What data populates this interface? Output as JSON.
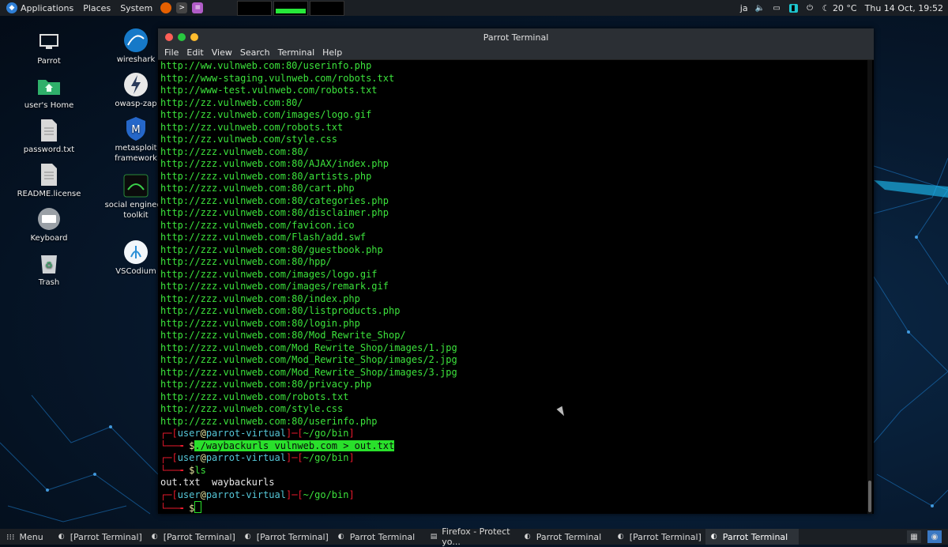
{
  "top_panel": {
    "menus": [
      "Applications",
      "Places",
      "System"
    ],
    "keyboard_layout": "ja",
    "weather": "20 °C",
    "clock": "Thu 14 Oct, 19:52"
  },
  "desktop_icons": {
    "col1": [
      "Parrot",
      "user's Home",
      "password.txt",
      "README.license",
      "Keyboard",
      "Trash"
    ],
    "col2": [
      "wireshark",
      "owasp-zap",
      "metasploit\nframework",
      "social engineeri\ntoolkit",
      "VSCodium"
    ]
  },
  "window": {
    "title": "Parrot Terminal",
    "menu": [
      "File",
      "Edit",
      "View",
      "Search",
      "Terminal",
      "Help"
    ]
  },
  "terminal": {
    "urls": [
      "http://ww.vulnweb.com:80/userinfo.php",
      "http://www-staging.vulnweb.com/robots.txt",
      "http://www-test.vulnweb.com/robots.txt",
      "http://zz.vulnweb.com:80/",
      "http://zz.vulnweb.com/images/logo.gif",
      "http://zz.vulnweb.com/robots.txt",
      "http://zz.vulnweb.com/style.css",
      "http://zzz.vulnweb.com:80/",
      "http://zzz.vulnweb.com:80/AJAX/index.php",
      "http://zzz.vulnweb.com:80/artists.php",
      "http://zzz.vulnweb.com:80/cart.php",
      "http://zzz.vulnweb.com:80/categories.php",
      "http://zzz.vulnweb.com:80/disclaimer.php",
      "http://zzz.vulnweb.com/favicon.ico",
      "http://zzz.vulnweb.com/Flash/add.swf",
      "http://zzz.vulnweb.com:80/guestbook.php",
      "http://zzz.vulnweb.com:80/hpp/",
      "http://zzz.vulnweb.com/images/logo.gif",
      "http://zzz.vulnweb.com/images/remark.gif",
      "http://zzz.vulnweb.com:80/index.php",
      "http://zzz.vulnweb.com:80/listproducts.php",
      "http://zzz.vulnweb.com:80/login.php",
      "http://zzz.vulnweb.com:80/Mod_Rewrite_Shop/",
      "http://zzz.vulnweb.com/Mod_Rewrite_Shop/images/1.jpg",
      "http://zzz.vulnweb.com/Mod_Rewrite_Shop/images/2.jpg",
      "http://zzz.vulnweb.com/Mod_Rewrite_Shop/images/3.jpg",
      "http://zzz.vulnweb.com:80/privacy.php",
      "http://zzz.vulnweb.com/robots.txt",
      "http://zzz.vulnweb.com/style.css",
      "http://zzz.vulnweb.com:80/userinfo.php"
    ],
    "prompt": {
      "user": "user",
      "at": "@",
      "host": "parrot-virtual",
      "path": "~/go/bin"
    },
    "cmd1": "./waybackurls vulnweb.com > out.txt",
    "cmd2": "ls",
    "ls_output": "out.txt  waybackurls"
  },
  "taskbar": {
    "menu_label": "Menu",
    "tasks": [
      "[Parrot Terminal]",
      "[Parrot Terminal]",
      "[Parrot Terminal]",
      "Parrot Terminal",
      "Firefox - Protect yo...",
      "Parrot Terminal",
      "[Parrot Terminal]",
      "Parrot Terminal"
    ],
    "active_index": 7
  }
}
